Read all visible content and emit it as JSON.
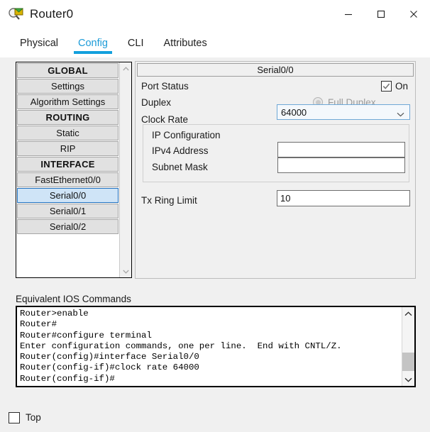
{
  "window": {
    "title": "Router0",
    "icon": "inspect-router-icon",
    "controls": {
      "minimize": "—",
      "maximize": "☐",
      "close": "✕"
    }
  },
  "tabs": [
    {
      "label": "Physical",
      "active": false
    },
    {
      "label": "Config",
      "active": true
    },
    {
      "label": "CLI",
      "active": false
    },
    {
      "label": "Attributes",
      "active": false
    }
  ],
  "sidebar": {
    "items": [
      {
        "label": "GLOBAL",
        "type": "header"
      },
      {
        "label": "Settings",
        "type": "item"
      },
      {
        "label": "Algorithm Settings",
        "type": "item"
      },
      {
        "label": "ROUTING",
        "type": "header"
      },
      {
        "label": "Static",
        "type": "item"
      },
      {
        "label": "RIP",
        "type": "item"
      },
      {
        "label": "INTERFACE",
        "type": "header"
      },
      {
        "label": "FastEthernet0/0",
        "type": "item"
      },
      {
        "label": "Serial0/0",
        "type": "item",
        "selected": true
      },
      {
        "label": "Serial0/1",
        "type": "item"
      },
      {
        "label": "Serial0/2",
        "type": "item"
      }
    ],
    "scroll_up_icon": "chevron-up-icon",
    "scroll_down_icon": "chevron-down-icon"
  },
  "config": {
    "panel_title": "Serial0/0",
    "port_status": {
      "label": "Port Status",
      "checked": true,
      "state_label": "On"
    },
    "duplex": {
      "label": "Duplex",
      "option_label": "Full Duplex",
      "selected": true,
      "disabled": true
    },
    "clock_rate": {
      "label": "Clock Rate",
      "value": "64000",
      "dropdown_icon": "chevron-down-icon"
    },
    "ip_configuration": {
      "title": "IP Configuration",
      "ipv4": {
        "label": "IPv4 Address",
        "value": "",
        "placeholder": ""
      },
      "subnet": {
        "label": "Subnet Mask",
        "value": "",
        "placeholder": ""
      }
    },
    "tx_ring_limit": {
      "label": "Tx Ring Limit",
      "value": "10"
    }
  },
  "ios": {
    "label": "Equivalent IOS Commands",
    "lines": [
      "Router>enable",
      "Router#",
      "Router#configure terminal",
      "Enter configuration commands, one per line.  End with CNTL/Z.",
      "Router(config)#interface Serial0/0",
      "Router(config-if)#clock rate 64000",
      "Router(config-if)#"
    ],
    "scroll_up_icon": "chevron-up-icon",
    "scroll_down_icon": "chevron-down-icon"
  },
  "bottom": {
    "top_checkbox": {
      "label": "Top",
      "checked": false
    }
  },
  "colors": {
    "accent": "#13a0dd",
    "selection": "#cfe4f7",
    "selection_border": "#1f6fbd",
    "panel_bg": "#f0f0f0",
    "button_bg": "#e1e1e1"
  }
}
